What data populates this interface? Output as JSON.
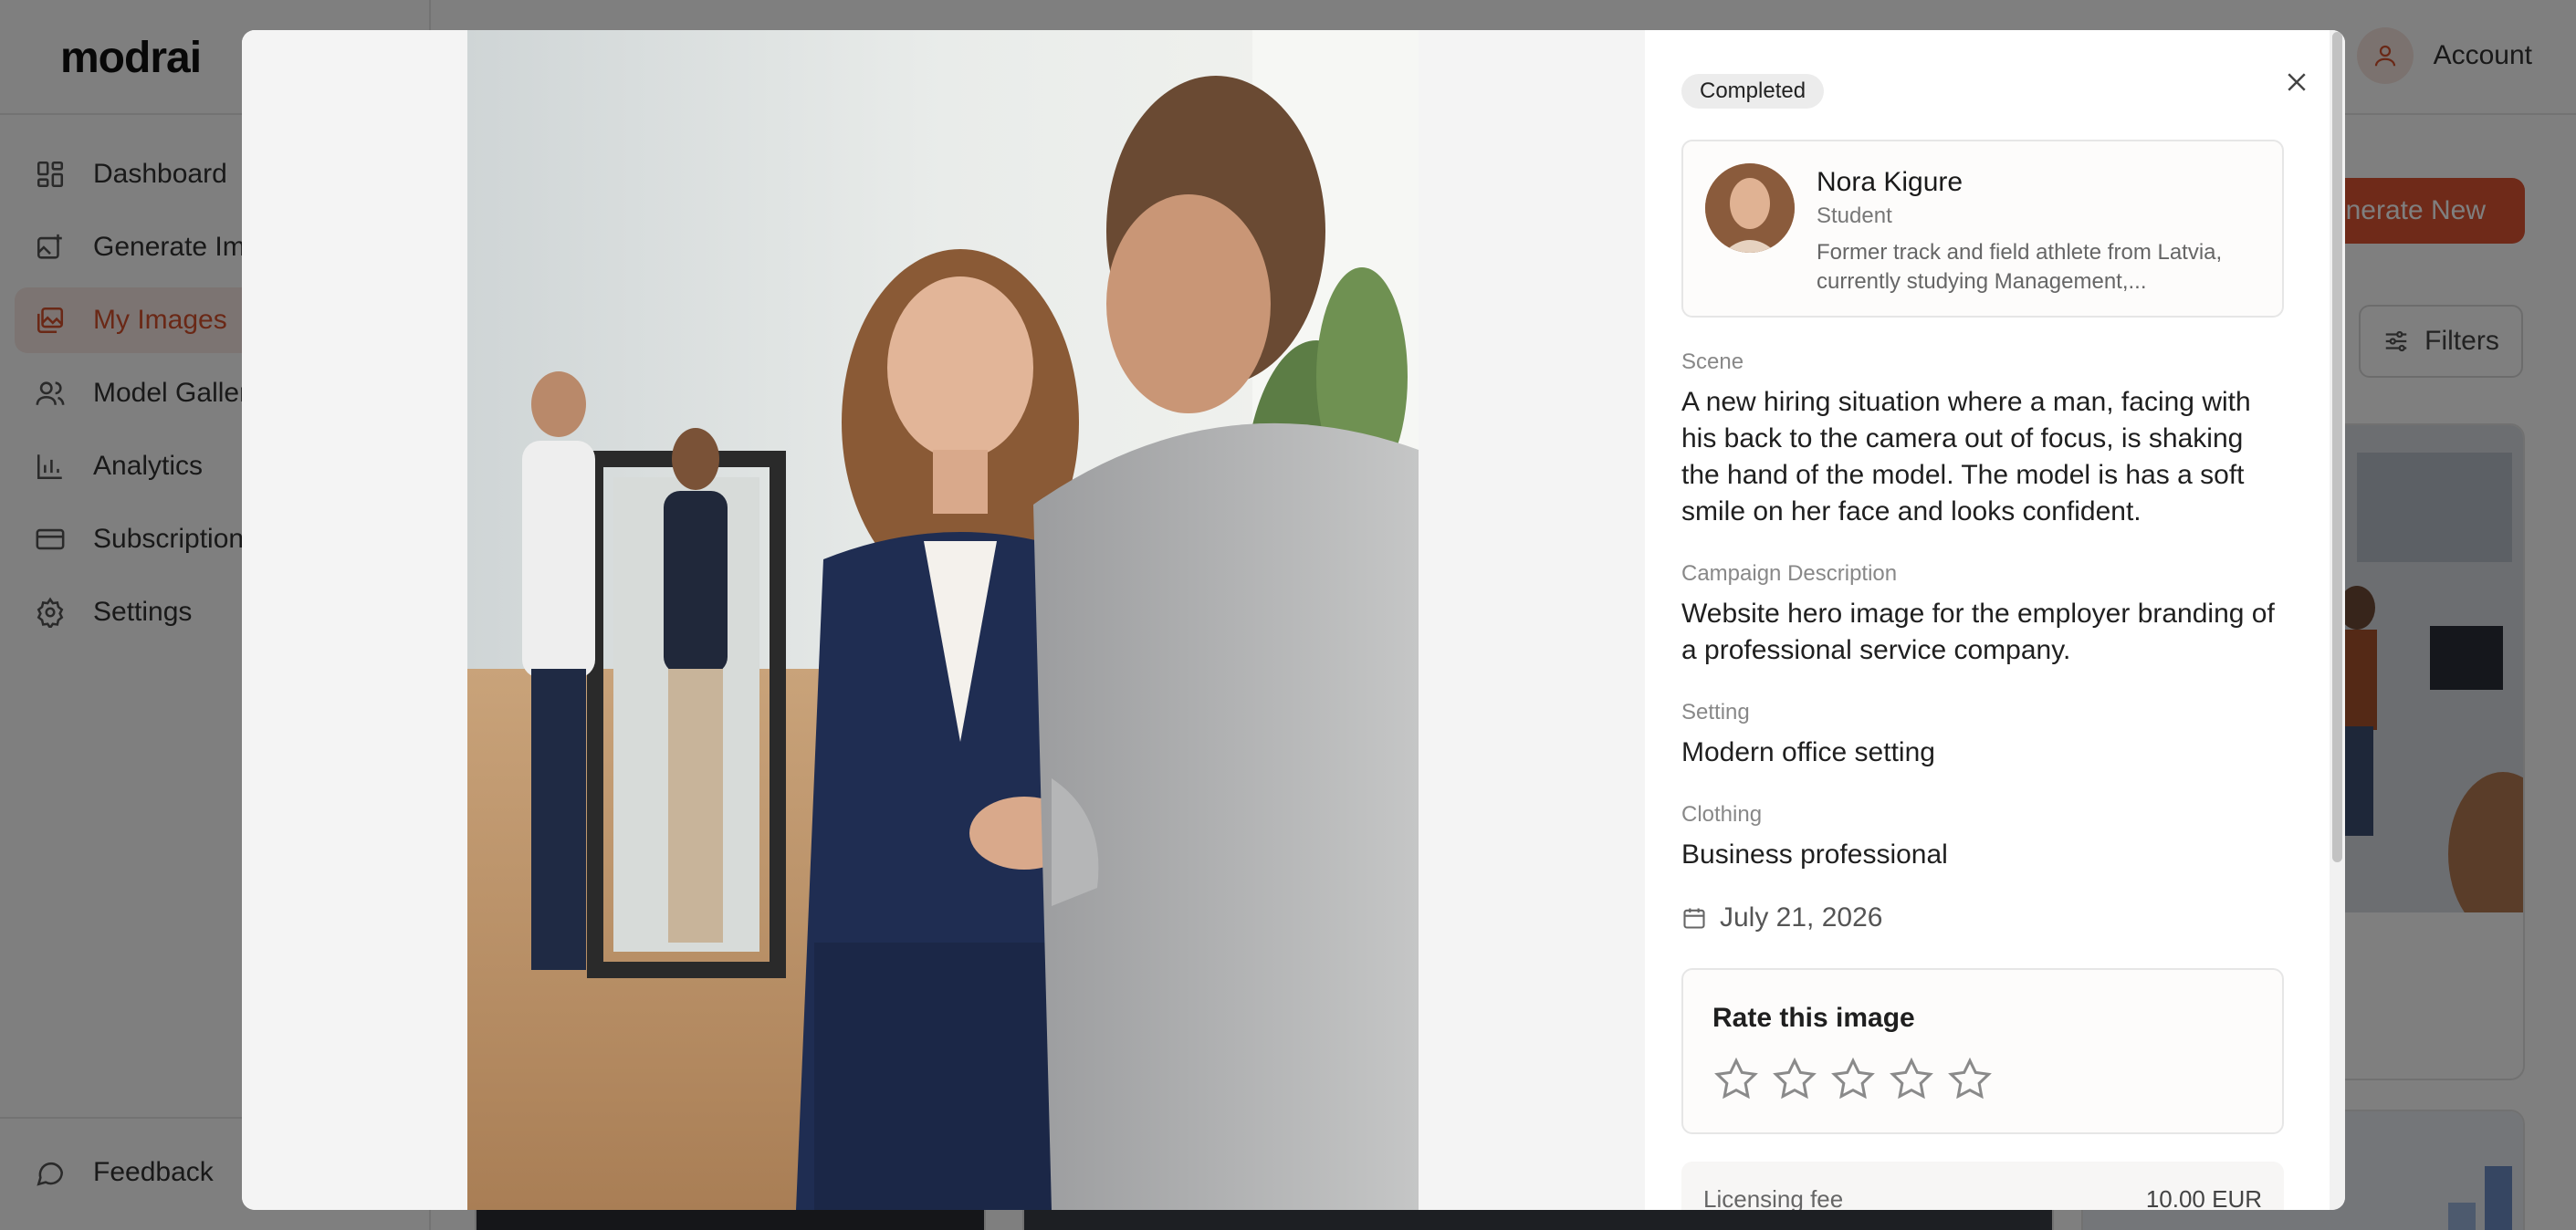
{
  "app": {
    "logo": "modrai"
  },
  "sidebar": {
    "items": [
      {
        "label": "Dashboard",
        "icon": "dashboard-icon"
      },
      {
        "label": "Generate Ima",
        "icon": "image-plus-icon"
      },
      {
        "label": "My Images",
        "icon": "images-icon",
        "active": true
      },
      {
        "label": "Model Galler",
        "icon": "users-icon"
      },
      {
        "label": "Analytics",
        "icon": "bar-chart-icon"
      },
      {
        "label": "Subscription",
        "icon": "credit-card-icon"
      },
      {
        "label": "Settings",
        "icon": "gear-icon"
      }
    ],
    "feedback": "Feedback"
  },
  "header": {
    "account": "Account"
  },
  "main": {
    "generate_new": "enerate New",
    "filters": "Filters"
  },
  "modal": {
    "status": "Completed",
    "model": {
      "name": "Nora Kigure",
      "role": "Student",
      "bio": "Former track and field athlete from Latvia, currently studying Management,..."
    },
    "fields": {
      "scene_label": "Scene",
      "scene_value": "A new hiring situation where a man, facing with his back to the camera out of focus, is shaking the hand of the model. The model is has a soft smile on her face and looks confident.",
      "campaign_label": "Campaign Description",
      "campaign_value": "Website hero image for the employer branding of a professional service company.",
      "setting_label": "Setting",
      "setting_value": "Modern office setting",
      "clothing_label": "Clothing",
      "clothing_value": "Business professional"
    },
    "date": "July 21, 2026",
    "rating": {
      "title": "Rate this image",
      "max": 5,
      "value": 0
    },
    "license": {
      "label": "Licensing fee",
      "value": "10.00 EUR"
    }
  },
  "colors": {
    "accent": "#de5532",
    "active_bg": "#f8e9e5",
    "overlay": "rgba(0,0,0,0.5)"
  }
}
